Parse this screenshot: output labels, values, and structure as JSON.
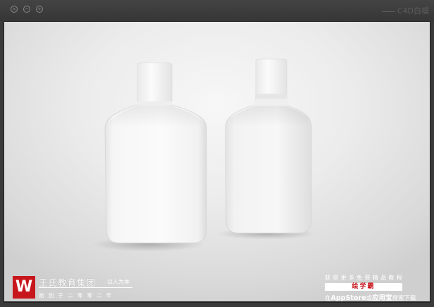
{
  "window": {
    "title": "C4D白模",
    "buttons": [
      {
        "name": "close",
        "glyph": "×"
      },
      {
        "name": "minimize",
        "glyph": "−"
      },
      {
        "name": "maximize",
        "glyph": "+"
      }
    ]
  },
  "watermark_brand": {
    "logo_text": "W",
    "name": "王氏教育集团",
    "motto": "以人为本",
    "since": "始创于二零零二年"
  },
  "watermark_promo": {
    "line1": "获得更多免费精品教程",
    "highlight": "绘学霸",
    "line3_prefix": "在",
    "line3_store1": "AppStore",
    "line3_or": "或",
    "line3_store2": "应用宝",
    "line3_suffix": "搜索下载"
  },
  "colors": {
    "titlebar": "#3a3a3a",
    "accent_red": "#c8161d",
    "bottle": "#ffffff",
    "backdrop": "#e6e6e6"
  }
}
